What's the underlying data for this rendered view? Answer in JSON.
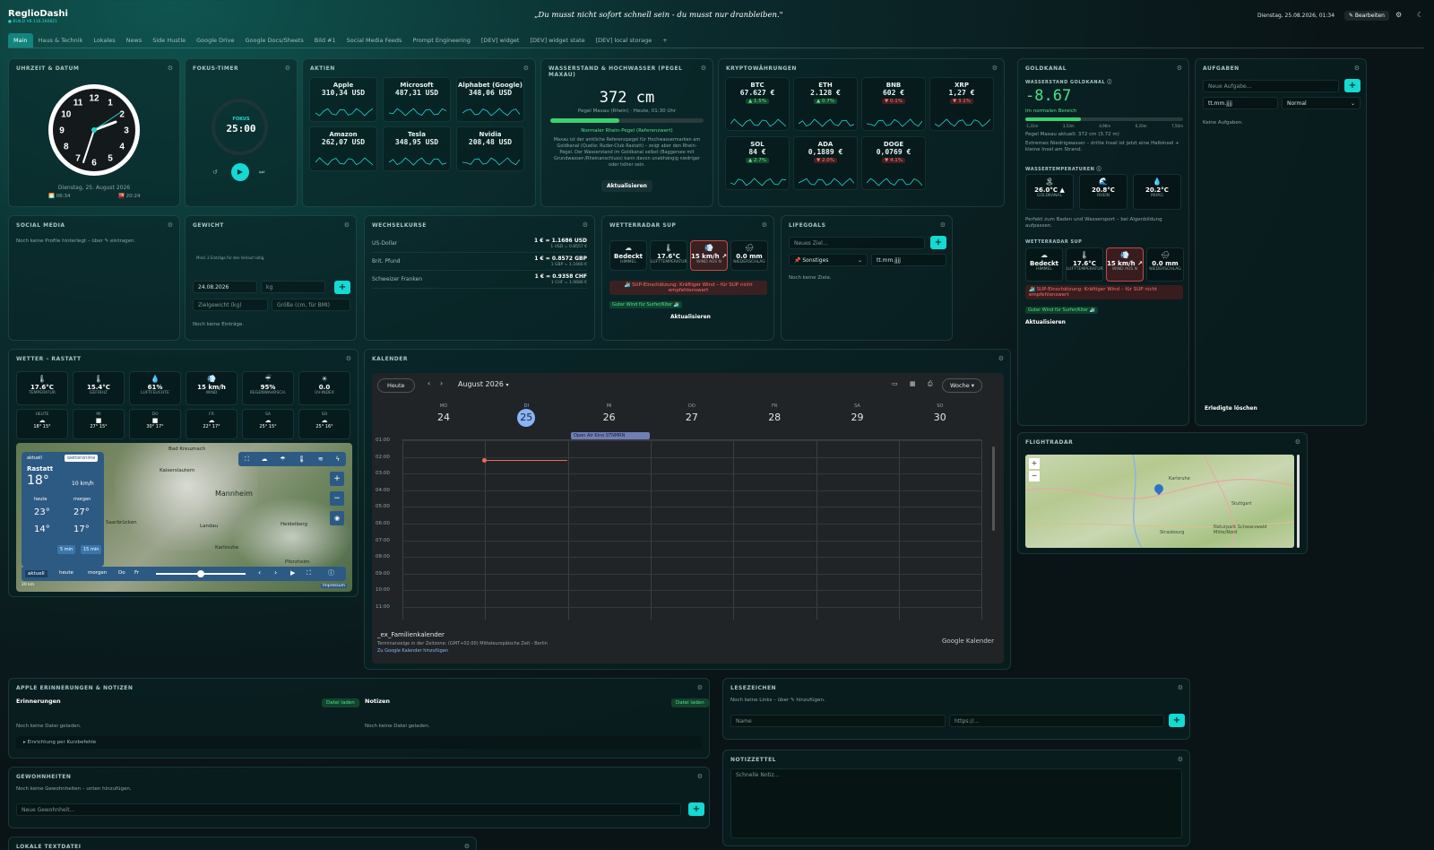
{
  "app": {
    "title": "ReglioDashi",
    "build": "● BUILD V8.116.260821",
    "quote": "„Du musst nicht sofort schnell sein - du musst nur dranbleiben.\"",
    "date": "Dienstag, 25.08.2026, 01:34",
    "edit": "✎ Bearbeiten"
  },
  "tabs": [
    "Main",
    "Haus & Technik",
    "Lokales",
    "News",
    "Side Hustle",
    "Google Drive",
    "Google Docs/Sheets",
    "Bild #1",
    "Social Media Feeds",
    "Prompt Engineering",
    "[DEV] widget",
    "[DEV] widget state",
    "[DEV] local storage",
    "+"
  ],
  "clock": {
    "title": "UHRZEIT & DATUM",
    "date": "Dienstag, 25. August 2026",
    "sunrise": "06:34",
    "sunset": "20:24",
    "numbers": [
      "12",
      "1",
      "2",
      "3",
      "4",
      "5",
      "6",
      "7",
      "8",
      "9",
      "10",
      "11"
    ]
  },
  "focus": {
    "title": "FOKUS-TIMER",
    "label": "FOKUS",
    "time": "25:00"
  },
  "stocks": {
    "title": "AKTIEN",
    "items": [
      {
        "name": "Apple",
        "value": "310,34 USD"
      },
      {
        "name": "Microsoft",
        "value": "487,31 USD"
      },
      {
        "name": "Alphabet (Google)",
        "value": "348,06 USD"
      },
      {
        "name": "Amazon",
        "value": "262,07 USD"
      },
      {
        "name": "Tesla",
        "value": "348,95 USD"
      },
      {
        "name": "Nvidia",
        "value": "208,48 USD"
      }
    ]
  },
  "water": {
    "title": "WASSERSTAND & HOCHWASSER (PEGEL MAXAU)",
    "value": "372 cm",
    "sub": "Pegel Maxau (Rhein) · Heute, 01:30 Uhr",
    "level": 0.45,
    "status": "Normaler Rhein-Pegel (Referenzwert)",
    "desc": "Maxau ist der amtliche Referenzpegel für Hochwassermarken am Goldkanal (Quelle: Ruder-Club Rastatt) – zeigt aber den Rhein-Pegel. Der Wasserstand im Goldkanal selbst (Baggersee mit Grundwasser-/Rheinanschluss) kann davon unabhängig niedriger oder höher sein.",
    "button": "Aktualisieren"
  },
  "crypto": {
    "title": "KRYPTOWÄHRUNGEN",
    "items": [
      {
        "name": "BTC",
        "value": "67.627 €",
        "chg": "▲ 1.5%",
        "up": true
      },
      {
        "name": "ETH",
        "value": "2.128 €",
        "chg": "▲ 0.7%",
        "up": true
      },
      {
        "name": "BNB",
        "value": "602 €",
        "chg": "▼ 0.1%",
        "up": false
      },
      {
        "name": "XRP",
        "value": "1,27 €",
        "chg": "▼ 3.1%",
        "up": false
      },
      {
        "name": "SOL",
        "value": "84 €",
        "chg": "▲ 2.7%",
        "up": true
      },
      {
        "name": "ADA",
        "value": "0,1889 €",
        "chg": "▼ 2.0%",
        "up": false
      },
      {
        "name": "DOGE",
        "value": "0,0769 €",
        "chg": "▼ 4.1%",
        "up": false
      }
    ]
  },
  "goldkanal": {
    "title": "GOLDKANAL",
    "sub": "WASSERSTAND GOLDKANAL ⓘ",
    "value": "-8.67",
    "range": "Im normalen Bereich",
    "level": 0.35,
    "ticks": [
      "-1,31m",
      "3,53m",
      "4,96m",
      "6,20m",
      "7,50m"
    ],
    "pegel": "Pegel Maxau aktuell: 372 cm (3.72 m)",
    "note": "Extremes Niedrigwasser – dritte Insel ist jetzt eine Halbinsel + kleine Insel am Strand.",
    "temp_title": "WASSERTEMPERATUREN ⓘ",
    "temps": [
      {
        "v": "26.0°C ▲",
        "l": "GOLDKANAL",
        "ic": "🏝"
      },
      {
        "v": "20.8°C",
        "l": "RHEIN",
        "ic": "🌊"
      },
      {
        "v": "20.2°C",
        "l": "MURG",
        "ic": "💧"
      }
    ],
    "temp_note": "Perfekt zum Baden und Wassersport – bei Algenbildung aufpassen.",
    "radar_title": "WETTERRADAR SUP",
    "radar": [
      {
        "v": "Bedeckt",
        "l": "HIMMEL",
        "ic": "☁"
      },
      {
        "v": "17.6°C",
        "l": "LUFTTEMPERATUR",
        "ic": "🌡"
      },
      {
        "v": "15 km/h ↗",
        "l": "WIND AUS N",
        "ic": "💨"
      },
      {
        "v": "0.0 mm",
        "l": "NIEDERSCHLAG",
        "ic": "🌧"
      }
    ],
    "warn": "🏄 SUP-Einschätzung: Kräftiger Wind – für SUP nicht empfehlenswert",
    "good": "Guter Wind für Surfer/Kiter 🏄",
    "button": "Aktualisieren"
  },
  "tasks": {
    "title": "AUFGABEN",
    "placeholder": "Neue Aufgabe...",
    "date": "tt.mm.jjjj",
    "prio": "Normal",
    "empty": "Keine Aufgaben.",
    "done": "Erledigte löschen"
  },
  "social": {
    "title": "SOCIAL MEDIA",
    "empty": "Noch keine Profile hinterlegt – über ✎ eintragen."
  },
  "weight": {
    "title": "GEWICHT",
    "hint": "Mind. 2 Einträge für den Verlauf nötig.",
    "date": "24.08.2026",
    "kg": "kg",
    "goal": "Zielgewicht (kg)",
    "height": "Größe (cm, für BMI)",
    "empty": "Noch keine Einträge."
  },
  "fx": {
    "title": "WECHSELKURSE",
    "rows": [
      {
        "name": "US-Dollar",
        "main": "1 € = 1.1686 USD",
        "sub": "1 USD = 0.8557 €"
      },
      {
        "name": "Brit. Pfund",
        "main": "1 € = 0.8572 GBP",
        "sub": "1 GBP = 1.1666 €"
      },
      {
        "name": "Schweizer Franken",
        "main": "1 € = 0.9358 CHF",
        "sub": "1 CHF = 1.0686 €"
      }
    ]
  },
  "sup": {
    "title": "WETTERRADAR SUP",
    "tiles": [
      {
        "v": "Bedeckt",
        "l": "HIMMEL",
        "ic": "☁"
      },
      {
        "v": "17.6°C",
        "l": "LUFTTEMPERATUR",
        "ic": "🌡"
      },
      {
        "v": "15 km/h ↗",
        "l": "WIND AUS N",
        "ic": "💨"
      },
      {
        "v": "0.0 mm",
        "l": "NIEDERSCHLAG",
        "ic": "🌧"
      }
    ],
    "warn": "🏄 SUP-Einschätzung: Kräftiger Wind – für SUP nicht empfehlenswert",
    "good": "Guter Wind für Surfer/Kiter 🏄",
    "button": "Aktualisieren"
  },
  "lifegoals": {
    "title": "LIFEGOALS",
    "placeholder": "Neues Ziel...",
    "cat": "📌 Sonstiges",
    "date": "tt.mm.jjjj",
    "empty": "Noch keine Ziele."
  },
  "weather": {
    "title": "WETTER – RASTATT",
    "now": [
      {
        "v": "17.6°C",
        "l": "TEMPERATUR",
        "ic": "🌡"
      },
      {
        "v": "15.4°C",
        "l": "GEFÜHLT",
        "ic": "🌡"
      },
      {
        "v": "61%",
        "l": "LUFTFEUCHTE",
        "ic": "💧"
      },
      {
        "v": "15 km/h",
        "l": "WIND",
        "ic": "💨"
      },
      {
        "v": "95%",
        "l": "REGENWAHRSCH.",
        "ic": "☔"
      },
      {
        "v": "0.0",
        "l": "UV-INDEX",
        "ic": "☀"
      }
    ],
    "days": [
      {
        "d": "HEUTE",
        "t": "18° 15°",
        "ic": "☁"
      },
      {
        "d": "MI",
        "t": "27° 15°",
        "ic": "■"
      },
      {
        "d": "DO",
        "t": "30° 17°",
        "ic": "■"
      },
      {
        "d": "FR",
        "t": "22° 17°",
        "ic": "☁"
      },
      {
        "d": "SA",
        "t": "25° 15°",
        "ic": "☁"
      },
      {
        "d": "SO",
        "t": "25° 16°",
        "ic": "☁"
      }
    ],
    "map": {
      "aktuell": "aktuell",
      "brand": "wetteronline",
      "city": "Rastatt",
      "temp": "18°",
      "wind": "10 km/h",
      "heute": "heute",
      "morgen": "morgen",
      "h1": "23°",
      "h2": "14°",
      "m1": "27°",
      "m2": "17°",
      "t5": "5 min",
      "t15": "15 min",
      "bar": [
        "aktuell",
        "heute",
        "morgen",
        "Do",
        "Fr"
      ],
      "cities": [
        "Bad Kreuznach",
        "Kaiserslautern",
        "Mannheim",
        "Heidelberg",
        "Landau",
        "Karlsruhe",
        "Saarbrücken",
        "Pforzheim"
      ],
      "scale": "20 km",
      "imp": "Impressum"
    }
  },
  "calendar": {
    "title": "KALENDER",
    "today": "Heute",
    "month": "August 2026",
    "view": "Woche",
    "days": [
      {
        "d": "MO",
        "n": "24"
      },
      {
        "d": "DI",
        "n": "25"
      },
      {
        "d": "MI",
        "n": "26"
      },
      {
        "d": "DO",
        "n": "27"
      },
      {
        "d": "FR",
        "n": "28"
      },
      {
        "d": "SA",
        "n": "29"
      },
      {
        "d": "SO",
        "n": "30"
      }
    ],
    "event": "Open Air Kino STNMRN",
    "hours": [
      "01:00",
      "02:00",
      "03:00",
      "04:00",
      "05:00",
      "06:00",
      "07:00",
      "08:00",
      "09:00",
      "10:00",
      "11:00"
    ],
    "cal_name": "_ex_Familienkalender",
    "tz": "Terminanzeige in der Zeitzone: (GMT+02:00) Mitteleuropäische Zeit - Berlin",
    "add": "Zu Google Kalender hinzufügen",
    "brand": "Google Kalender"
  },
  "flight": {
    "title": "FLIGHTRADAR",
    "cities": [
      "Karlsruhe",
      "Stuttgart",
      "Strasbourg",
      "Naturpark Schwarzwald Mitte/Nord"
    ]
  },
  "apple": {
    "title": "APPLE ERINNERUNGEN & NOTIZEN",
    "rem": "Erinnerungen",
    "notes": "Notizen",
    "load": "Datei laden",
    "empty": "Noch keine Datei geladen.",
    "setup": "▸ Einrichtung per Kurzbefehle"
  },
  "bookmarks": {
    "title": "LESEZEICHEN",
    "empty": "Noch keine Links – über ✎ hinzufügen.",
    "name": "Name",
    "url": "https://..."
  },
  "habits": {
    "title": "GEWOHNHEITEN",
    "empty": "Noch keine Gewohnheiten – unten hinzufügen.",
    "placeholder": "Neue Gewohnheit..."
  },
  "notes": {
    "title": "NOTIZZETTEL",
    "placeholder": "Schnelle Notiz..."
  },
  "localtext": {
    "title": "LOKALE TEXTDATEI"
  }
}
